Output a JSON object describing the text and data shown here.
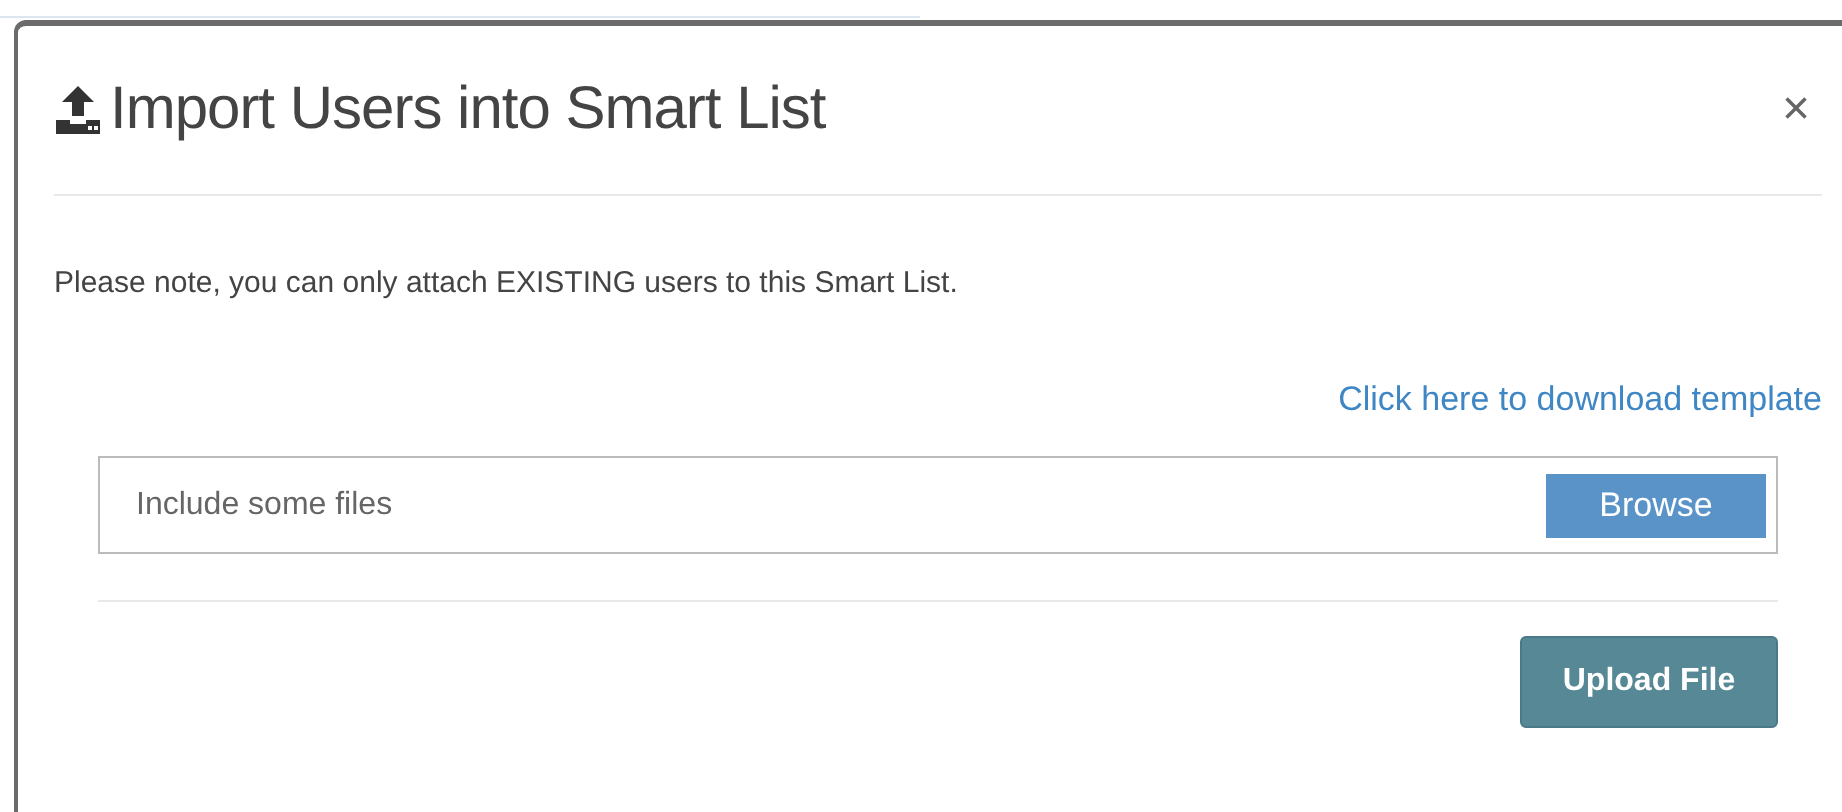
{
  "dialog": {
    "title": "Import Users into Smart List",
    "close": "×"
  },
  "note": "Please note, you can only attach EXISTING users to this Smart List.",
  "template_link": "Click here to download template",
  "file_field": {
    "placeholder": "Include some files",
    "browse": "Browse"
  },
  "upload_button": "Upload File"
}
